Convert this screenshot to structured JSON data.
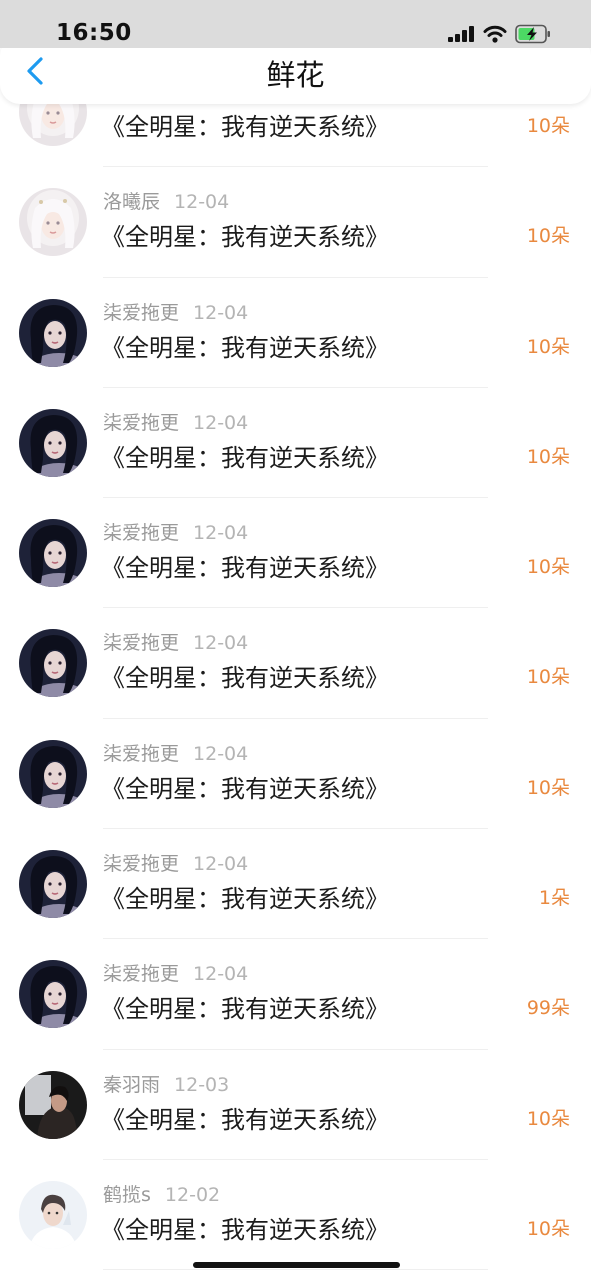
{
  "status": {
    "time": "16:50"
  },
  "nav": {
    "title": "鲜花"
  },
  "list": [
    {
      "name": "",
      "date": "",
      "book": "《全明星：我有逆天系统》",
      "amount": "10朵",
      "avatar": "girl-white-hair"
    },
    {
      "name": "洛曦辰",
      "date": "12-04",
      "book": "《全明星：我有逆天系统》",
      "amount": "10朵",
      "avatar": "girl-white-hair"
    },
    {
      "name": "柒爱拖更",
      "date": "12-04",
      "book": "《全明星：我有逆天系统》",
      "amount": "10朵",
      "avatar": "girl-dark-hair"
    },
    {
      "name": "柒爱拖更",
      "date": "12-04",
      "book": "《全明星：我有逆天系统》",
      "amount": "10朵",
      "avatar": "girl-dark-hair"
    },
    {
      "name": "柒爱拖更",
      "date": "12-04",
      "book": "《全明星：我有逆天系统》",
      "amount": "10朵",
      "avatar": "girl-dark-hair"
    },
    {
      "name": "柒爱拖更",
      "date": "12-04",
      "book": "《全明星：我有逆天系统》",
      "amount": "10朵",
      "avatar": "girl-dark-hair"
    },
    {
      "name": "柒爱拖更",
      "date": "12-04",
      "book": "《全明星：我有逆天系统》",
      "amount": "10朵",
      "avatar": "girl-dark-hair"
    },
    {
      "name": "柒爱拖更",
      "date": "12-04",
      "book": "《全明星：我有逆天系统》",
      "amount": "1朵",
      "avatar": "girl-dark-hair"
    },
    {
      "name": "柒爱拖更",
      "date": "12-04",
      "book": "《全明星：我有逆天系统》",
      "amount": "99朵",
      "avatar": "girl-dark-hair"
    },
    {
      "name": "秦羽雨",
      "date": "12-03",
      "book": "《全明星：我有逆天系统》",
      "amount": "10朵",
      "avatar": "person-window"
    },
    {
      "name": "鹤揽s",
      "date": "12-02",
      "book": "《全明星：我有逆天系统》",
      "amount": "10朵",
      "avatar": "boy-light"
    }
  ],
  "colors": {
    "accent": "#1e9bf0",
    "amount": "#e9893f",
    "status_bar": "#dcdcdc",
    "battery": "#4cd964"
  },
  "icons": [
    "back-arrow-icon",
    "signal-icon",
    "wifi-icon",
    "battery-icon"
  ]
}
